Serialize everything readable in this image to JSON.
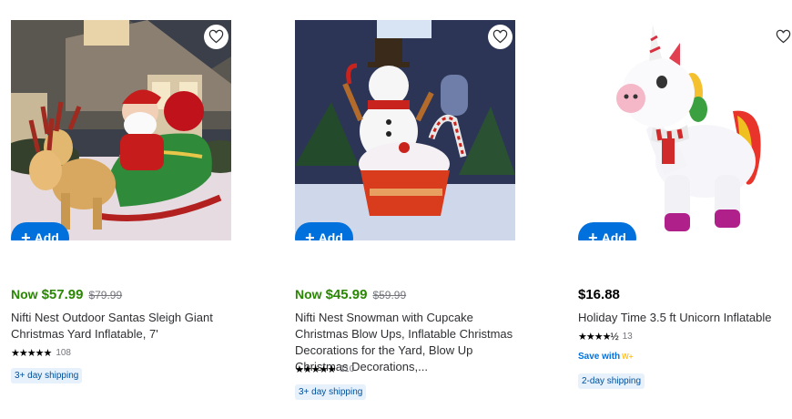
{
  "products": [
    {
      "image_alt": "Nifti Nest Outdoor Santas Sleigh Giant Christmas Yard Inflatable",
      "add_label": "Add",
      "price_prefix": "Now",
      "price": "$57.99",
      "was_price": "$79.99",
      "title": "Nifti Nest Outdoor Santas Sleigh Giant Christmas Yard Inflatable, 7'",
      "stars": "★★★★★",
      "rating": 5,
      "review_count": "108",
      "shipping": "3+ day shipping"
    },
    {
      "image_alt": "Nifti Nest Snowman with Cupcake inflatable",
      "add_label": "Add",
      "price_prefix": "Now",
      "price": "$45.99",
      "was_price": "$59.99",
      "title": "Nifti Nest Snowman with Cupcake Christmas Blow Ups, Inflatable Christmas Decorations for the Yard, Blow Up Christmas Decorations,...",
      "stars": "★★★★★",
      "rating": 5,
      "review_count": "110",
      "shipping": "3+ day shipping"
    },
    {
      "image_alt": "Holiday Time 3.5 ft Unicorn Inflatable",
      "add_label": "Add",
      "price": "$16.88",
      "title": "Holiday Time 3.5 ft Unicorn Inflatable",
      "stars": "★★★★½",
      "rating": 4.5,
      "review_count": "13",
      "save_with": "Save with",
      "save_with_badge": "W+",
      "shipping": "2-day shipping"
    }
  ],
  "icons": {
    "favorite": "heart-icon",
    "add": "plus-icon",
    "rating": "star-icon"
  },
  "colors": {
    "accent_blue": "#0071dc",
    "sale_green": "#2a8703",
    "shipping_bg": "#e6f1fc",
    "walmart_plus_yellow": "#ffc220"
  }
}
